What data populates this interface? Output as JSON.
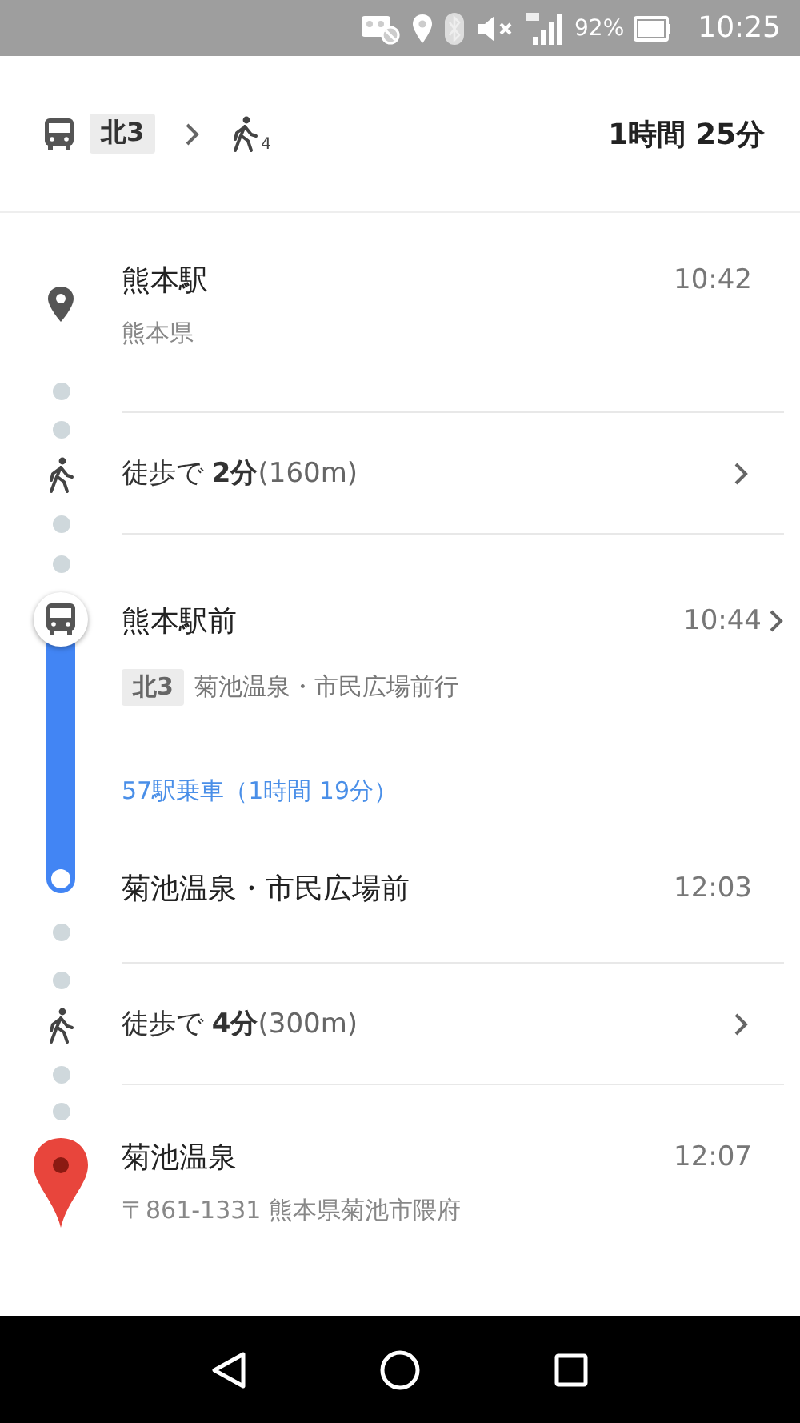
{
  "status_bar": {
    "battery": "92%",
    "time": "10:25"
  },
  "summary": {
    "segments": [
      {
        "kind": "bus",
        "route": "北3"
      },
      {
        "kind": "walk",
        "minutes": "4"
      }
    ],
    "duration": "1時間 25分"
  },
  "steps": [
    {
      "kind": "origin",
      "name": "熊本駅",
      "time": "10:42",
      "detail": "熊本県"
    },
    {
      "kind": "walk",
      "label": "徒歩で **2分**",
      "distance": "(160m)"
    },
    {
      "kind": "transit",
      "name": "熊本駅前",
      "time": "10:44",
      "route": "北3",
      "headsign": "菊池温泉・市民広場前行",
      "ride": "57駅乗車（1時間 19分）",
      "end_name": "菊池温泉・市民広場前",
      "end_time": "12:03"
    },
    {
      "kind": "walk",
      "label": "徒歩で **4分**",
      "distance": "(300m)"
    },
    {
      "kind": "destination",
      "name": "菊池温泉",
      "time": "12:07",
      "detail": "〒861-1331 熊本県菊池市隈府"
    }
  ]
}
